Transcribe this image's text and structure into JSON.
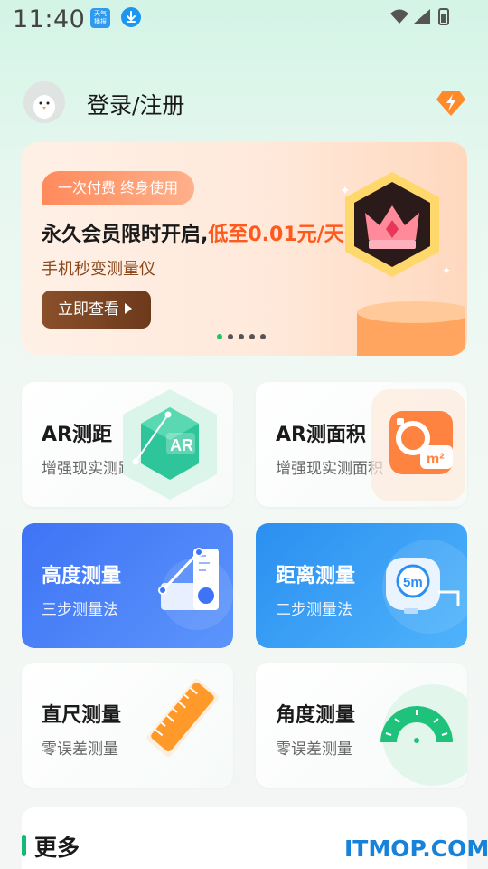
{
  "status_bar": {
    "time": "11:40",
    "app_icon_text": "天气\n播报"
  },
  "header": {
    "login_label": "登录/注册"
  },
  "banner": {
    "tag": "一次付费 终身使用",
    "title_prefix": "永久会员限时开启,",
    "title_highlight": "低至0.01元/天",
    "subtitle": "手机秒变测量仪",
    "button_label": "立即查看",
    "active_slide": 1,
    "slide_count": 5
  },
  "cards": [
    {
      "title": "AR测距",
      "subtitle": "增强现实测距",
      "icon": "ar-distance-icon"
    },
    {
      "title": "AR测面积",
      "subtitle": "增强现实测面积",
      "icon": "ar-area-icon"
    },
    {
      "title": "高度测量",
      "subtitle": "三步测量法",
      "icon": "height-measure-icon"
    },
    {
      "title": "距离测量",
      "subtitle": "二步测量法",
      "icon": "tape-measure-icon"
    },
    {
      "title": "直尺测量",
      "subtitle": "零误差测量",
      "icon": "ruler-icon"
    },
    {
      "title": "角度测量",
      "subtitle": "零误差测量",
      "icon": "protractor-icon"
    }
  ],
  "more": {
    "title": "更多"
  },
  "watermark": "ITMOP.COM",
  "colors": {
    "accent_green": "#17b978",
    "banner_highlight": "#ff5a1e",
    "blue_card_1": "#3f73f5",
    "blue_card_2": "#2a8ff0"
  }
}
